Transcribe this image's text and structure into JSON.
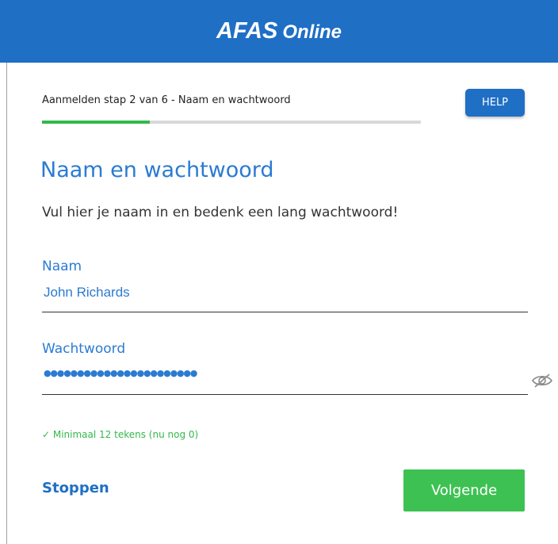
{
  "header": {
    "logo_brand": "AFAS",
    "logo_sub": "Online",
    "background_color": "#1f6fc5"
  },
  "progress": {
    "step_label": "Aanmelden stap 2 van 6 - Naam en wachtwoord",
    "current_step": 2,
    "total_steps": 6,
    "fill_fraction": 0.285,
    "fill_color": "#33b94a"
  },
  "help_button": {
    "label": "HELP"
  },
  "main": {
    "title": "Naam en wachtwoord",
    "subtitle": "Vul hier je naam in en bedenk een lang wachtwoord!"
  },
  "form": {
    "name": {
      "label": "Naam",
      "value": "John Richards"
    },
    "password": {
      "label": "Wachtwoord",
      "masked_value": "●●●●●●●●●●●●●●●●●●●●●●●",
      "toggle_icon": "eye-slash-icon"
    },
    "hint": "✓ Minimaal 12 tekens (nu nog 0)"
  },
  "actions": {
    "stop_label": "Stoppen",
    "next_label": "Volgende",
    "next_color": "#3ec153"
  }
}
